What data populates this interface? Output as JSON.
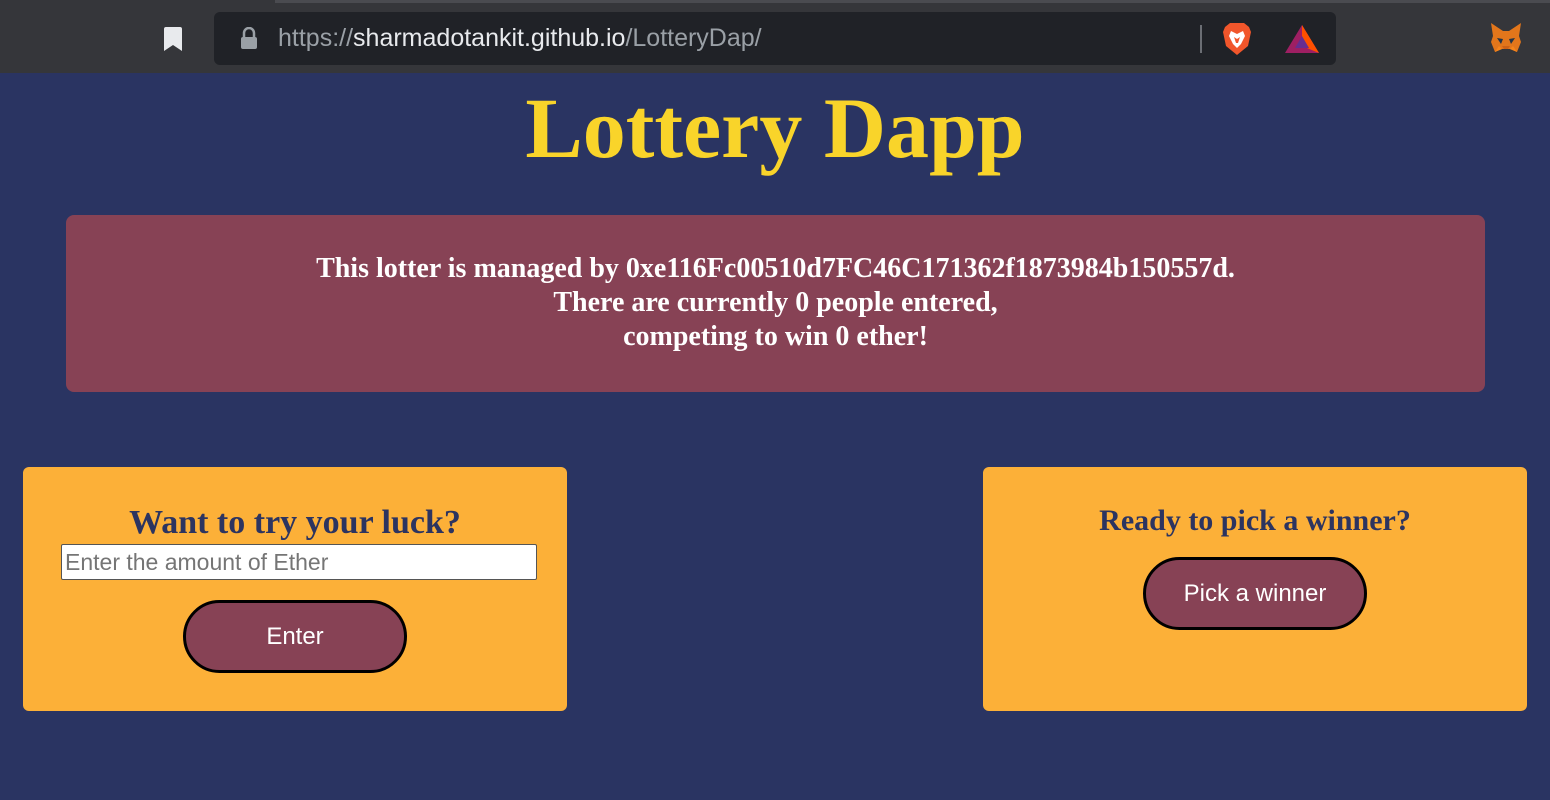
{
  "browser": {
    "url_scheme": "https://",
    "url_host": "sharmadotankit.github.io",
    "url_path": "/LotteryDap/",
    "icons": [
      "bookmark-icon",
      "lock-icon",
      "brave-lion-icon",
      "bat-triangle-icon",
      "metamask-fox-icon"
    ]
  },
  "page": {
    "title": "Lottery Dapp",
    "info_line1": "This lotter is managed by 0xe116Fc00510d7FC46C171362f1873984b150557d.",
    "info_line2": "There are currently 0 people entered,",
    "info_line3": "competing to win 0 ether!"
  },
  "enter_card": {
    "heading": "Want to try your luck?",
    "input_value": "",
    "input_placeholder": "Enter the amount of Ether",
    "button_label": "Enter"
  },
  "winner_card": {
    "heading": "Ready to pick a winner?",
    "button_label": "Pick a winner"
  },
  "colors": {
    "background": "#2a3462",
    "title": "#f9d42a",
    "info_box": "#874255",
    "card": "#fcb038",
    "button": "#874255"
  }
}
